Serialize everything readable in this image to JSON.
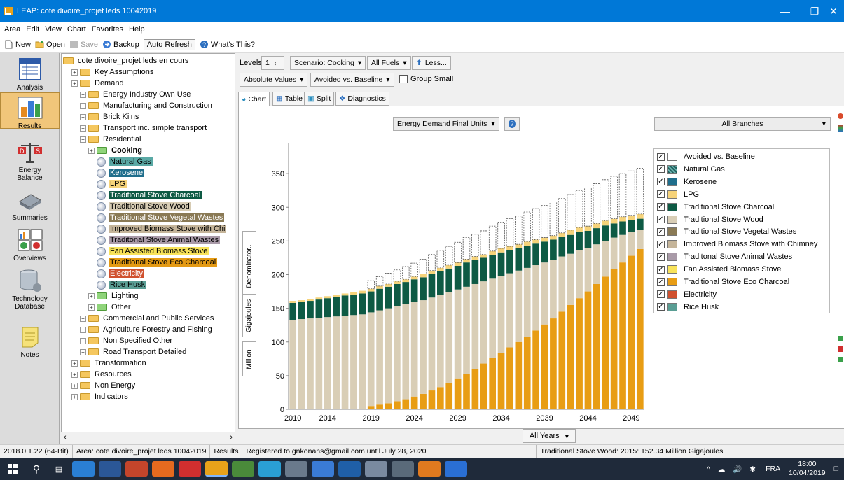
{
  "window": {
    "title": "LEAP: cote divoire_projet leds 10042019"
  },
  "menu": [
    "Area",
    "Edit",
    "View",
    "Chart",
    "Favorites",
    "Help"
  ],
  "toolbar": {
    "new": "New",
    "open": "Open",
    "save": "Save",
    "backup": "Backup",
    "auto_refresh": "Auto Refresh",
    "whats_this": "What's This?"
  },
  "nav": [
    "Analysis",
    "Results",
    "Energy Balance",
    "Summaries",
    "Overviews",
    "Technology Database",
    "Notes"
  ],
  "tree": [
    {
      "label": "cote divoire_projet leds en cours",
      "depth": 0,
      "type": "root"
    },
    {
      "label": "Key Assumptions",
      "depth": 1,
      "type": "folder"
    },
    {
      "label": "Demand",
      "depth": 1,
      "type": "folder"
    },
    {
      "label": "Energy Industry Own Use",
      "depth": 2,
      "type": "folder"
    },
    {
      "label": "Manufacturing and Construction",
      "depth": 2,
      "type": "folder"
    },
    {
      "label": "Brick Kilns",
      "depth": 2,
      "type": "folder"
    },
    {
      "label": "Transport inc. simple transport",
      "depth": 2,
      "type": "folder"
    },
    {
      "label": "Residential",
      "depth": 2,
      "type": "folder"
    },
    {
      "label": "Cooking",
      "depth": 3,
      "type": "green"
    },
    {
      "label": "Natural Gas",
      "depth": 4,
      "type": "leaf",
      "bg": "#5aa9a5"
    },
    {
      "label": "Kerosene",
      "depth": 4,
      "type": "leaf",
      "bg": "#1f6e8c",
      "fg": "#fff"
    },
    {
      "label": "LPG",
      "depth": 4,
      "type": "leaf",
      "bg": "#f6d37a"
    },
    {
      "label": "Traditional Stove Charcoal",
      "depth": 4,
      "type": "leaf",
      "bg": "#0e5a44",
      "fg": "#fff"
    },
    {
      "label": "Traditional Stove Wood",
      "depth": 4,
      "type": "leaf",
      "bg": "#d7ccb4"
    },
    {
      "label": "Traditional Stove Vegetal Wastes",
      "depth": 4,
      "type": "leaf",
      "bg": "#8a7a55",
      "fg": "#fff"
    },
    {
      "label": "Improved Biomass Stove with Chi",
      "depth": 4,
      "type": "leaf",
      "bg": "#c5b59a"
    },
    {
      "label": "Traditonal Stove Animal Wastes",
      "depth": 4,
      "type": "leaf",
      "bg": "#a99aa8"
    },
    {
      "label": "Fan Assisted Biomass Stove",
      "depth": 4,
      "type": "leaf",
      "bg": "#f8e35a"
    },
    {
      "label": "Traditional Stove Eco Charcoal",
      "depth": 4,
      "type": "leaf",
      "bg": "#e49a14"
    },
    {
      "label": "Electricity",
      "depth": 4,
      "type": "leaf",
      "bg": "#d0512f",
      "fg": "#fff"
    },
    {
      "label": "Rice Husk",
      "depth": 4,
      "type": "leaf",
      "bg": "#5a9e94"
    },
    {
      "label": "Lighting",
      "depth": 3,
      "type": "green"
    },
    {
      "label": "Other",
      "depth": 3,
      "type": "green"
    },
    {
      "label": "Commercial and Public Services",
      "depth": 2,
      "type": "folder"
    },
    {
      "label": "Agriculture Forestry and Fishing",
      "depth": 2,
      "type": "folder"
    },
    {
      "label": "Non Specified Other",
      "depth": 2,
      "type": "folder"
    },
    {
      "label": "Road Transport Detailed",
      "depth": 2,
      "type": "folder"
    },
    {
      "label": "Transformation",
      "depth": 1,
      "type": "folder"
    },
    {
      "label": "Resources",
      "depth": 1,
      "type": "folder"
    },
    {
      "label": "Non Energy",
      "depth": 1,
      "type": "folder"
    },
    {
      "label": "Indicators",
      "depth": 1,
      "type": "folder"
    }
  ],
  "controls": {
    "levels_label": "Levels:",
    "levels_value": "1",
    "scenario": "Scenario: Cooking",
    "fuels": "All Fuels",
    "less": "Less...",
    "value_type": "Absolute Values",
    "comparison": "Avoided vs. Baseline",
    "group_small": "Group Small",
    "unit_select": "Energy Demand Final Units",
    "branch_select": "All Branches",
    "years_select": "All Years"
  },
  "tabs": [
    "Chart",
    "Table",
    "Split",
    "Diagnostics"
  ],
  "vertical_labels": [
    "Denominator..",
    "Gigajoules",
    "Million"
  ],
  "legend": [
    {
      "label": "Avoided vs. Baseline",
      "color": "#ffffff"
    },
    {
      "label": "Natural Gas",
      "color": "#3d8c8a",
      "hatch": true
    },
    {
      "label": "Kerosene",
      "color": "#1f6e8c"
    },
    {
      "label": "LPG",
      "color": "#f6d37a"
    },
    {
      "label": "Traditional Stove Charcoal",
      "color": "#0e5a44"
    },
    {
      "label": "Traditional Stove Wood",
      "color": "#d9ceb6"
    },
    {
      "label": "Traditional Stove Vegetal Wastes",
      "color": "#8a7a55"
    },
    {
      "label": "Improved Biomass Stove with Chimney",
      "color": "#c5b59a"
    },
    {
      "label": "Traditonal Stove Animal Wastes",
      "color": "#a99aa8"
    },
    {
      "label": "Fan Assisted Biomass Stove",
      "color": "#f8e35a"
    },
    {
      "label": "Traditional Stove Eco Charcoal",
      "color": "#e89d14"
    },
    {
      "label": "Electricity",
      "color": "#d0512f"
    },
    {
      "label": "Rice Husk",
      "color": "#5a9e94"
    }
  ],
  "status": {
    "version": "2018.0.1.22 (64-Bit)",
    "area": "Area: cote divoire_projet leds 10042019",
    "view": "Results",
    "registered": "Registered to gnkonans@gmail.com until July 28, 2020",
    "hover": "Traditional Stove Wood: 2015: 152.34 Million Gigajoules"
  },
  "taskbar": {
    "lang": "FRA",
    "time": "18:00",
    "date": "10/04/2019"
  },
  "chart_data": {
    "type": "bar",
    "stacked": true,
    "x": [
      2010,
      2011,
      2012,
      2013,
      2014,
      2015,
      2016,
      2017,
      2018,
      2019,
      2020,
      2021,
      2022,
      2023,
      2024,
      2025,
      2026,
      2027,
      2028,
      2029,
      2030,
      2031,
      2032,
      2033,
      2034,
      2035,
      2036,
      2037,
      2038,
      2039,
      2040,
      2041,
      2042,
      2043,
      2044,
      2045,
      2046,
      2047,
      2048,
      2049,
      2050
    ],
    "x_tick_labels": [
      "2010",
      "2014",
      "2019",
      "2024",
      "2029",
      "2034",
      "2039",
      "2044",
      "2049"
    ],
    "y_ticks": [
      0,
      50,
      100,
      150,
      200,
      250,
      300,
      350
    ],
    "ylim": [
      0,
      400
    ],
    "series": [
      {
        "name": "Traditional Stove Eco Charcoal",
        "color": "#e89d14",
        "values": [
          0,
          0,
          0,
          0,
          0,
          0,
          0,
          0,
          0,
          5,
          7,
          9,
          12,
          15,
          19,
          23,
          28,
          33,
          39,
          46,
          53,
          60,
          68,
          76,
          84,
          92,
          100,
          108,
          117,
          126,
          135,
          145,
          155,
          165,
          175,
          186,
          197,
          208,
          218,
          228,
          238
        ]
      },
      {
        "name": "Traditional Stove Wood",
        "color": "#d9ceb6",
        "values": [
          133,
          134,
          135,
          136,
          137,
          138,
          139,
          140,
          141,
          139,
          140,
          141,
          141,
          141,
          140,
          139,
          138,
          137,
          135,
          132,
          129,
          126,
          122,
          118,
          114,
          110,
          106,
          102,
          97,
          92,
          87,
          82,
          76,
          71,
          65,
          59,
          53,
          47,
          41,
          35,
          29
        ]
      },
      {
        "name": "Traditional Stove Charcoal",
        "color": "#0e5a44",
        "values": [
          25,
          25,
          26,
          27,
          28,
          29,
          30,
          30,
          31,
          31,
          32,
          32,
          33,
          33,
          34,
          34,
          35,
          35,
          35,
          35,
          36,
          36,
          35,
          35,
          35,
          34,
          33,
          33,
          32,
          31,
          30,
          29,
          28,
          27,
          25,
          24,
          23,
          21,
          20,
          18,
          16
        ]
      },
      {
        "name": "LPG",
        "color": "#f6d37a",
        "values": [
          3,
          3,
          3,
          3,
          3,
          3,
          3,
          4,
          4,
          4,
          4,
          4,
          4,
          4,
          4,
          5,
          5,
          5,
          5,
          5,
          5,
          5,
          5,
          6,
          6,
          6,
          6,
          6,
          6,
          6,
          6,
          6,
          7,
          7,
          7,
          7,
          7,
          7,
          7,
          7,
          7
        ]
      },
      {
        "name": "Avoided vs. Baseline",
        "color": "#ffffff",
        "dashed": true,
        "values": [
          0,
          0,
          0,
          0,
          0,
          0,
          0,
          0,
          0,
          12,
          14,
          16,
          17,
          19,
          20,
          22,
          24,
          26,
          28,
          30,
          32,
          33,
          35,
          37,
          39,
          41,
          42,
          44,
          46,
          48,
          50,
          51,
          53,
          55,
          57,
          59,
          61,
          63,
          64,
          66,
          68
        ]
      }
    ]
  }
}
